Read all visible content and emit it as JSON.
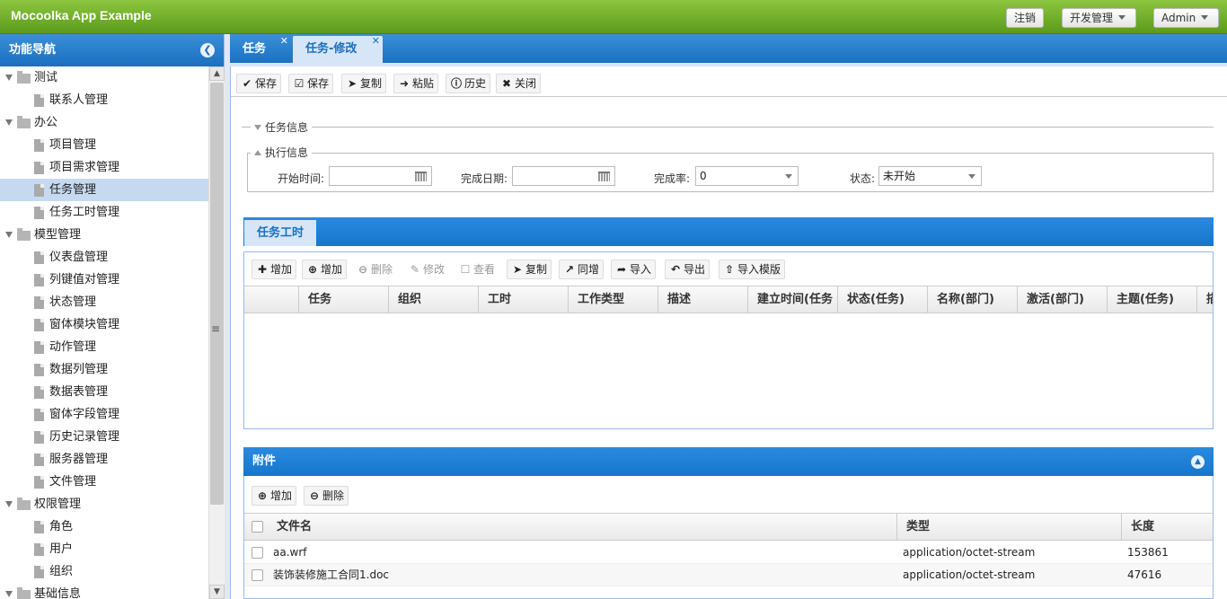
{
  "app": {
    "title": "Mocoolka App Example"
  },
  "topbar": {
    "logout": "注销",
    "dev_menu": "开发管理",
    "user_menu": "Admin"
  },
  "sidebar": {
    "title": "功能导航",
    "tree": [
      {
        "label": "测试",
        "type": "folder",
        "level": 0
      },
      {
        "label": "联系人管理",
        "type": "leaf",
        "level": 1
      },
      {
        "label": "办公",
        "type": "folder",
        "level": 0
      },
      {
        "label": "项目管理",
        "type": "leaf",
        "level": 1
      },
      {
        "label": "项目需求管理",
        "type": "leaf",
        "level": 1
      },
      {
        "label": "任务管理",
        "type": "leaf",
        "level": 1,
        "selected": true
      },
      {
        "label": "任务工时管理",
        "type": "leaf",
        "level": 1
      },
      {
        "label": "模型管理",
        "type": "folder",
        "level": 0
      },
      {
        "label": "仪表盘管理",
        "type": "leaf",
        "level": 1
      },
      {
        "label": "列键值对管理",
        "type": "leaf",
        "level": 1
      },
      {
        "label": "状态管理",
        "type": "leaf",
        "level": 1
      },
      {
        "label": "窗体模块管理",
        "type": "leaf",
        "level": 1
      },
      {
        "label": "动作管理",
        "type": "leaf",
        "level": 1
      },
      {
        "label": "数据列管理",
        "type": "leaf",
        "level": 1
      },
      {
        "label": "数据表管理",
        "type": "leaf",
        "level": 1
      },
      {
        "label": "窗体字段管理",
        "type": "leaf",
        "level": 1
      },
      {
        "label": "历史记录管理",
        "type": "leaf",
        "level": 1
      },
      {
        "label": "服务器管理",
        "type": "leaf",
        "level": 1
      },
      {
        "label": "文件管理",
        "type": "leaf",
        "level": 1
      },
      {
        "label": "权限管理",
        "type": "folder",
        "level": 0
      },
      {
        "label": "角色",
        "type": "leaf",
        "level": 1
      },
      {
        "label": "用户",
        "type": "leaf",
        "level": 1
      },
      {
        "label": "组织",
        "type": "leaf",
        "level": 1
      },
      {
        "label": "基础信息",
        "type": "folder",
        "level": 0
      }
    ]
  },
  "tabs": [
    {
      "label": "任务"
    },
    {
      "label": "任务-修改"
    }
  ],
  "toolbar": {
    "save1": "保存",
    "save2": "保存",
    "copy": "复制",
    "paste": "粘贴",
    "history": "历史",
    "close": "关闭"
  },
  "form": {
    "task_info_legend": "任务信息",
    "exec_info_legend": "执行信息",
    "start_time_label": "开始时间:",
    "start_time_value": "",
    "finish_date_label": "完成日期:",
    "finish_date_value": "",
    "completion_label": "完成率:",
    "completion_value": "0",
    "status_label": "状态:",
    "status_value": "未开始"
  },
  "worktime": {
    "tab": "任务工时",
    "buttons": {
      "add1": "增加",
      "add2": "增加",
      "delete": "删除",
      "edit": "修改",
      "view": "查看",
      "copy": "复制",
      "same_add": "同增",
      "import": "导入",
      "export": "导出",
      "import_template": "导入模版"
    },
    "columns": [
      "任务",
      "组织",
      "工时",
      "工作类型",
      "描述",
      "建立时间(任务",
      "状态(任务)",
      "名称(部门)",
      "激活(部门)",
      "主题(任务)",
      "描"
    ]
  },
  "attachments": {
    "title": "附件",
    "buttons": {
      "add": "增加",
      "delete": "删除"
    },
    "columns": {
      "filename": "文件名",
      "type": "类型",
      "length": "长度"
    },
    "rows": [
      {
        "filename": "aa.wrf",
        "type": "application/octet-stream",
        "length": "153861"
      },
      {
        "filename": "装饰装修施工合同1.doc",
        "type": "application/octet-stream",
        "length": "47616"
      }
    ]
  }
}
